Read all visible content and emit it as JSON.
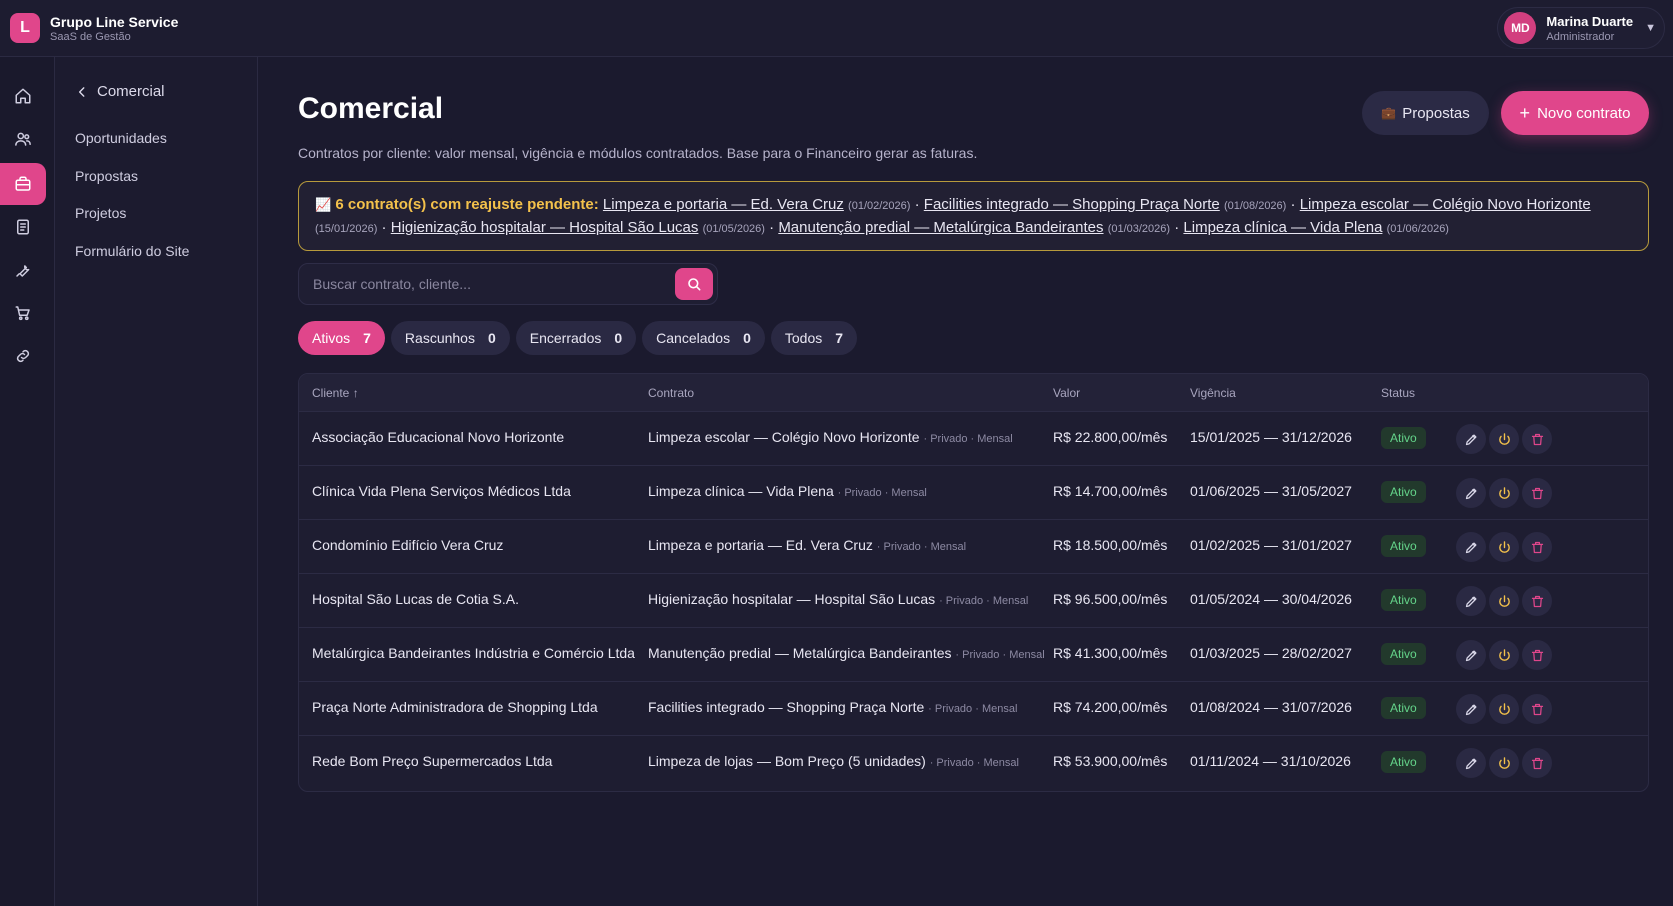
{
  "brand": {
    "initial": "L",
    "name": "Grupo Line Service",
    "subtitle": "SaaS de Gestão"
  },
  "user": {
    "initials": "MD",
    "name": "Marina Duarte",
    "role": "Administrador"
  },
  "rail": {
    "items": [
      {
        "icon": "home-icon"
      },
      {
        "icon": "users-icon"
      },
      {
        "icon": "briefcase-icon",
        "active": true
      },
      {
        "icon": "document-icon"
      },
      {
        "icon": "wrench-icon"
      },
      {
        "icon": "cart-icon"
      },
      {
        "icon": "link-icon"
      }
    ]
  },
  "subnav": {
    "back_label": "Comercial",
    "items": [
      "Oportunidades",
      "Propostas",
      "Projetos",
      "Formulário do Site"
    ]
  },
  "header": {
    "title": "Comercial",
    "description": "Contratos por cliente: valor mensal, vigência e módulos contratados. Base para o Financeiro gerar as faturas.",
    "proposals_button": "Propostas",
    "new_contract_button": "Novo contrato"
  },
  "alert": {
    "emoji": "📈",
    "lead": "6 contrato(s) com reajuste pendente:",
    "items": [
      {
        "label": "Limpeza e portaria — Ed. Vera Cruz",
        "date": "(01/02/2026)"
      },
      {
        "label": "Facilities integrado — Shopping Praça Norte",
        "date": "(01/08/2026)"
      },
      {
        "label": "Limpeza escolar — Colégio Novo Horizonte",
        "date": "(15/01/2026)"
      },
      {
        "label": "Higienização hospitalar — Hospital São Lucas",
        "date": "(01/05/2026)"
      },
      {
        "label": "Manutenção predial — Metalúrgica Bandeirantes",
        "date": "(01/03/2026)"
      },
      {
        "label": "Limpeza clínica — Vida Plena",
        "date": "(01/06/2026)"
      }
    ]
  },
  "search": {
    "placeholder": "Buscar contrato, cliente...",
    "value": ""
  },
  "tabs": [
    {
      "label": "Ativos",
      "count": "7",
      "active": true
    },
    {
      "label": "Rascunhos",
      "count": "0"
    },
    {
      "label": "Encerrados",
      "count": "0"
    },
    {
      "label": "Cancelados",
      "count": "0"
    },
    {
      "label": "Todos",
      "count": "7"
    }
  ],
  "table": {
    "columns": {
      "client": "Cliente ↑",
      "contract": "Contrato",
      "value": "Valor",
      "term": "Vigência",
      "status": "Status"
    },
    "rows": [
      {
        "client": "Associação Educacional Novo Horizonte",
        "contract": "Limpeza escolar — Colégio Novo Horizonte",
        "meta": "· Privado · Mensal",
        "value": "R$ 22.800,00/mês",
        "term": "15/01/2025 — 31/12/2026",
        "status": "Ativo"
      },
      {
        "client": "Clínica Vida Plena Serviços Médicos Ltda",
        "contract": "Limpeza clínica — Vida Plena",
        "meta": "· Privado · Mensal",
        "value": "R$ 14.700,00/mês",
        "term": "01/06/2025 — 31/05/2027",
        "status": "Ativo"
      },
      {
        "client": "Condomínio Edifício Vera Cruz",
        "contract": "Limpeza e portaria — Ed. Vera Cruz",
        "meta": "· Privado · Mensal",
        "value": "R$ 18.500,00/mês",
        "term": "01/02/2025 — 31/01/2027",
        "status": "Ativo"
      },
      {
        "client": "Hospital São Lucas de Cotia S.A.",
        "contract": "Higienização hospitalar — Hospital São Lucas",
        "meta": "· Privado · Mensal",
        "value": "R$ 96.500,00/mês",
        "term": "01/05/2024 — 30/04/2026",
        "status": "Ativo"
      },
      {
        "client": "Metalúrgica Bandeirantes Indústria e Comércio Ltda",
        "contract": "Manutenção predial — Metalúrgica Bandeirantes",
        "meta": "· Privado · Mensal",
        "value": "R$ 41.300,00/mês",
        "term": "01/03/2025 — 28/02/2027",
        "status": "Ativo"
      },
      {
        "client": "Praça Norte Administradora de Shopping Ltda",
        "contract": "Facilities integrado — Shopping Praça Norte",
        "meta": "· Privado · Mensal",
        "value": "R$ 74.200,00/mês",
        "term": "01/08/2024 — 31/07/2026",
        "status": "Ativo"
      },
      {
        "client": "Rede Bom Preço Supermercados Ltda",
        "contract": "Limpeza de lojas — Bom Preço (5 unidades)",
        "meta": "· Privado · Mensal",
        "value": "R$ 53.900,00/mês",
        "term": "01/11/2024 — 31/10/2026",
        "status": "Ativo"
      }
    ]
  },
  "colors": {
    "accent": "#e0468b",
    "background": "#1b1a2e",
    "alert_border": "#b79a3c",
    "status_ok": "#64d48a"
  }
}
